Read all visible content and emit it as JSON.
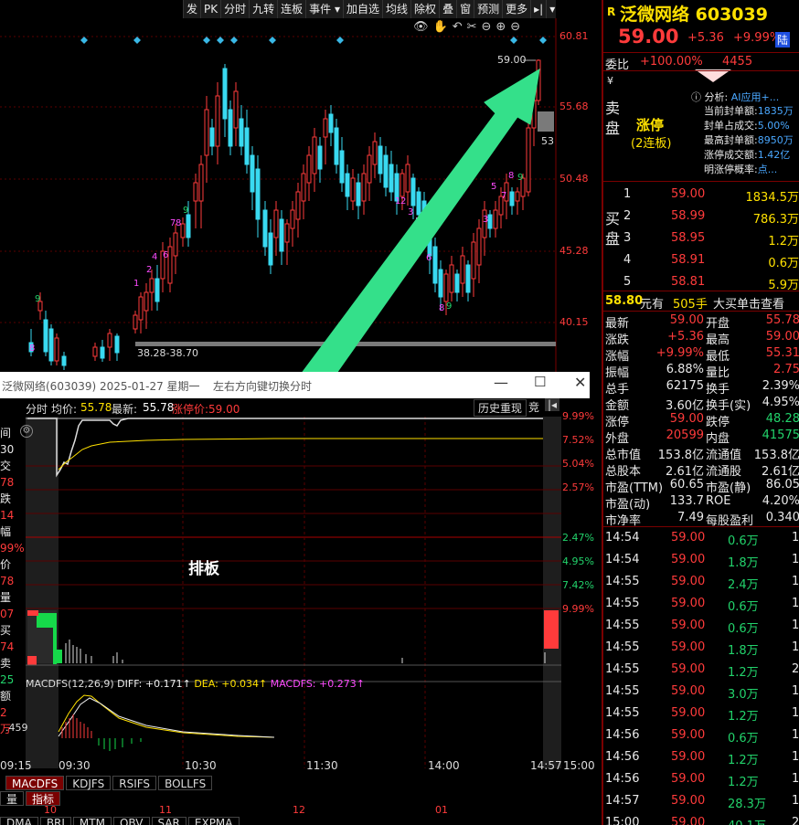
{
  "toolbar": {
    "items": [
      "发",
      "PK",
      "分时",
      "九转",
      "连板",
      "事件 ▾",
      "加自选",
      "均线",
      "除权",
      "叠",
      "窗",
      "预测",
      "更多",
      "▸|",
      "▾"
    ]
  },
  "kline": {
    "price_labels": [
      "60.81",
      "55.68",
      "50.48",
      "45.28",
      "40.15"
    ],
    "last_price_label": "59.00",
    "right_tag": "53",
    "range_label": "38.28-38.70",
    "annotation": "排板"
  },
  "stock": {
    "market_badge": "R",
    "name": "泛微网络",
    "code": "603039",
    "price": "59.00",
    "change": "+5.36",
    "pct": "+9.99%",
    "exchange_tag": "陆"
  },
  "order": {
    "webi_label": "委比",
    "webi": "+100.00%",
    "webi_vol": "4455"
  },
  "limit": {
    "sell_label": "卖盘",
    "status": "涨停",
    "boards": "(2连板)",
    "analysis_label": "分析:",
    "analysis_value": "AI应用+...",
    "items": [
      {
        "label": "当前封单额:",
        "value": "1835万"
      },
      {
        "label": "封单占成交:",
        "value": "5.00%"
      },
      {
        "label": "最高封单额:",
        "value": "8950万"
      },
      {
        "label": "涨停成交额:",
        "value": "1.42亿"
      },
      {
        "label": "明涨停概率:",
        "value": "点..."
      }
    ]
  },
  "buy": {
    "label": "买盘",
    "rows": [
      {
        "n": "1",
        "price": "59.00",
        "vol": "1834.5万"
      },
      {
        "n": "2",
        "price": "58.99",
        "vol": "786.3万"
      },
      {
        "n": "3",
        "price": "58.95",
        "vol": "1.2万"
      },
      {
        "n": "4",
        "price": "58.91",
        "vol": "0.6万"
      },
      {
        "n": "5",
        "price": "58.81",
        "vol": "5.9万"
      }
    ]
  },
  "big_order": {
    "price": "58.80",
    "text1": "元有",
    "vol": "505手",
    "link": "大买单击查看"
  },
  "stats": [
    {
      "l1": "最新",
      "v1": "59.00",
      "c1": "red",
      "l2": "开盘",
      "v2": "55.78",
      "c2": "red"
    },
    {
      "l1": "涨跌",
      "v1": "+5.36",
      "c1": "red",
      "l2": "最高",
      "v2": "59.00",
      "c2": "red"
    },
    {
      "l1": "涨幅",
      "v1": "+9.99%",
      "c1": "red",
      "l2": "最低",
      "v2": "55.31",
      "c2": "red"
    },
    {
      "l1": "振幅",
      "v1": "6.88%",
      "c1": "white",
      "l2": "量比",
      "v2": "2.75",
      "c2": "red"
    },
    {
      "l1": "总手",
      "v1": "62175",
      "c1": "white",
      "l2": "换手",
      "v2": "2.39%",
      "c2": "white"
    },
    {
      "l1": "金额",
      "v1": "3.60亿",
      "c1": "white",
      "l2": "换手(实)",
      "v2": "4.95%",
      "c2": "white"
    },
    {
      "l1": "涨停",
      "v1": "59.00",
      "c1": "red",
      "l2": "跌停",
      "v2": "48.28",
      "c2": "green"
    },
    {
      "l1": "外盘",
      "v1": "20599",
      "c1": "red",
      "l2": "内盘",
      "v2": "41575",
      "c2": "green"
    },
    {
      "l1": "总市值",
      "v1": "153.8亿",
      "c1": "white",
      "l2": "流通值",
      "v2": "153.8亿",
      "c2": "white"
    },
    {
      "l1": "总股本",
      "v1": "2.61亿",
      "c1": "white",
      "l2": "流通股",
      "v2": "2.61亿",
      "c2": "white"
    },
    {
      "l1": "市盈(TTM)",
      "v1": "60.65",
      "c1": "white",
      "l2": "市盈(静)",
      "v2": "86.05",
      "c2": "white"
    },
    {
      "l1": "市盈(动)",
      "v1": "133.7",
      "c1": "white",
      "l2": "ROE",
      "v2": "4.20%",
      "c2": "white"
    },
    {
      "l1": "市净率",
      "v1": "7.49",
      "c1": "white",
      "l2": "每股盈利",
      "v2": "0.340",
      "c2": "white"
    }
  ],
  "ticks": [
    {
      "t": "14:54",
      "p": "59.00",
      "v": "0.6万",
      "n": "1"
    },
    {
      "t": "14:54",
      "p": "59.00",
      "v": "1.8万",
      "n": "1"
    },
    {
      "t": "14:55",
      "p": "59.00",
      "v": "2.4万",
      "n": "1"
    },
    {
      "t": "14:55",
      "p": "59.00",
      "v": "0.6万",
      "n": "1"
    },
    {
      "t": "14:55",
      "p": "59.00",
      "v": "0.6万",
      "n": "1"
    },
    {
      "t": "14:55",
      "p": "59.00",
      "v": "1.8万",
      "n": "1"
    },
    {
      "t": "14:55",
      "p": "59.00",
      "v": "1.2万",
      "n": "2"
    },
    {
      "t": "14:55",
      "p": "59.00",
      "v": "3.0万",
      "n": "1"
    },
    {
      "t": "14:55",
      "p": "59.00",
      "v": "1.2万",
      "n": "1"
    },
    {
      "t": "14:56",
      "p": "59.00",
      "v": "0.6万",
      "n": "1"
    },
    {
      "t": "14:56",
      "p": "59.00",
      "v": "1.2万",
      "n": "1"
    },
    {
      "t": "14:56",
      "p": "59.00",
      "v": "1.2万",
      "n": "1"
    },
    {
      "t": "14:57",
      "p": "59.00",
      "v": "28.3万",
      "n": "1"
    },
    {
      "t": "15:00",
      "p": "59.00",
      "v": "40.1万",
      "n": "2"
    }
  ],
  "popup": {
    "title": "泛微网络(603039) 2025-01-27 星期一",
    "hint": "左右方向键切换分时",
    "header": {
      "l1": "分时",
      "l2": "均价:",
      "avg": "55.78",
      "l3": "最新:",
      "last": "55.78",
      "l4": "涨停价:59.00"
    },
    "history_btn": "历史重现",
    "bid_btn": "竞",
    "pct_up": [
      "9.99%",
      "7.52%",
      "5.04%",
      "2.57%"
    ],
    "pct_down": [
      "2.47%",
      "4.95%",
      "7.42%",
      "9.99%"
    ],
    "macd_label": "MACDFS(12,26,9)",
    "diff": "DIFF: +0.171↑",
    "dea": "DEA: +0.034↑",
    "macd": "MACDFS: +0.273↑",
    "macd_left": ".459",
    "times": [
      "09:15",
      "09:30",
      "10:30",
      "11:30",
      "14:00",
      "14:57",
      "15:00"
    ],
    "left_col": [
      "间",
      "30",
      "交",
      "78",
      "跌",
      "14",
      "幅",
      "99%",
      "价",
      "78",
      "量",
      "07",
      "买",
      "74",
      "卖",
      "25",
      "额",
      "2万"
    ]
  },
  "bottom": {
    "tabs": [
      "MACDFS",
      "KDJFS",
      "RSIFS",
      "BOLLFS"
    ],
    "row2": [
      "量",
      "指标"
    ],
    "nums": [
      "10",
      "11",
      "12",
      "01"
    ],
    "row3": [
      "DMA",
      "BRI",
      "MTM",
      "OBV",
      "SAR",
      "EXPMA"
    ]
  }
}
